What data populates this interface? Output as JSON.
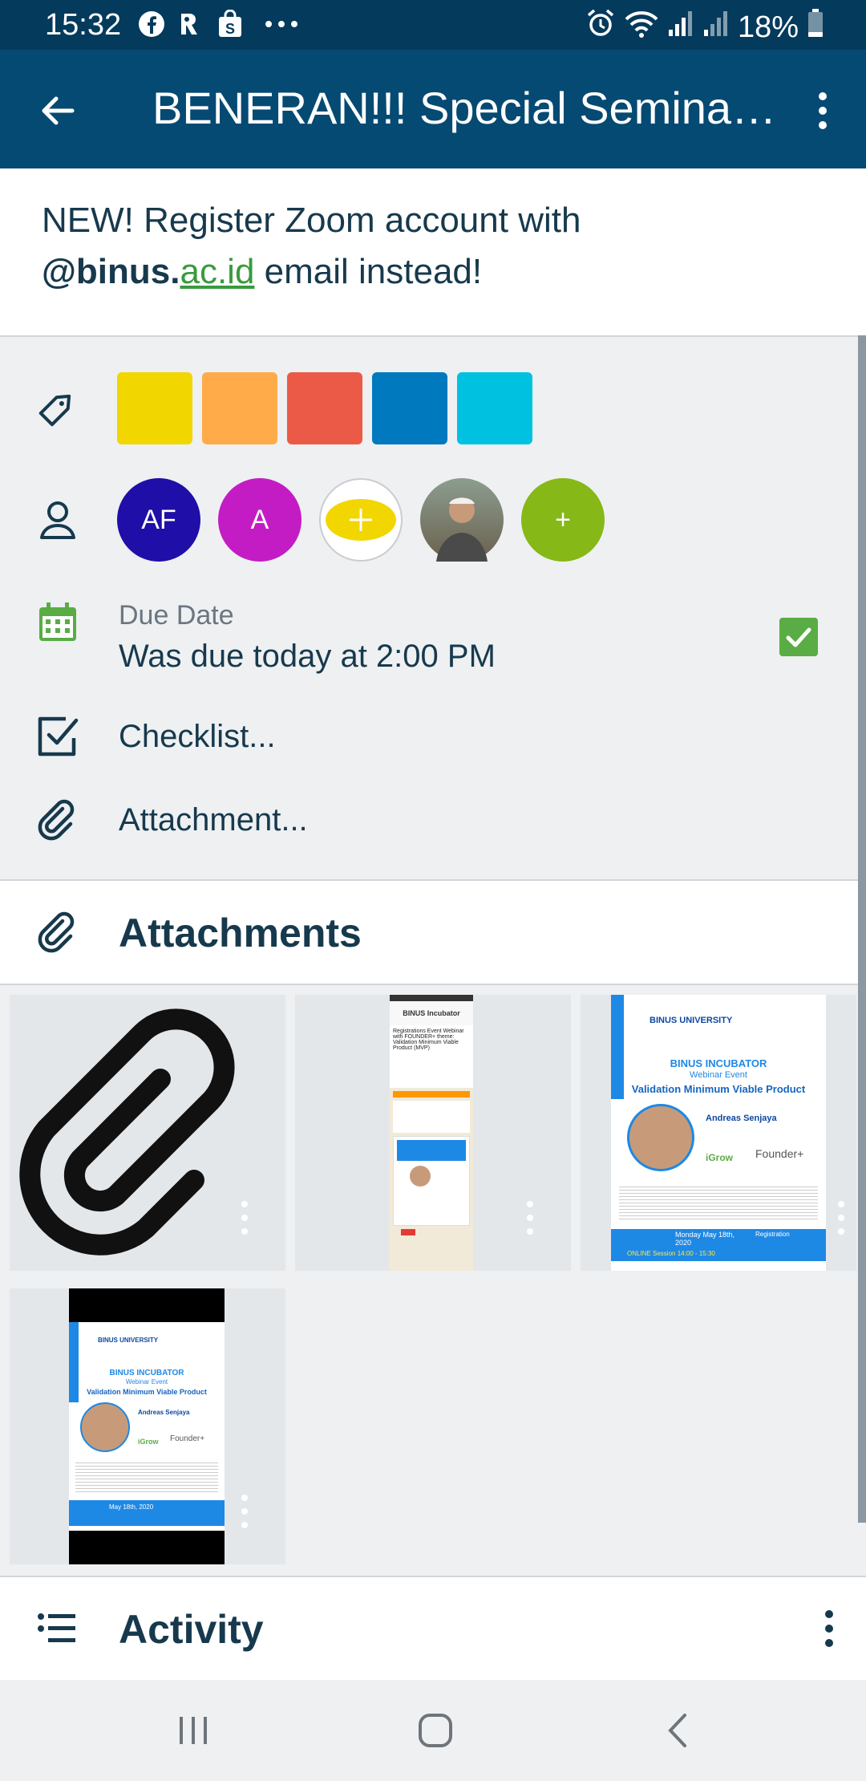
{
  "status_bar": {
    "time": "15:32",
    "notification_icons": [
      "facebook-icon",
      "app-icon",
      "shop-icon",
      "more-notifications-icon"
    ],
    "system_icons": [
      "alarm-icon",
      "wifi-icon",
      "signal-icon",
      "signal-icon-2",
      "battery-icon"
    ],
    "battery": "18%"
  },
  "app_bar": {
    "title": "BENERAN!!! Special Seminar...",
    "back_icon": "arrow-back-icon",
    "more_icon": "more-vert-icon"
  },
  "description": {
    "line1": "NEW! Register Zoom account with",
    "line2_bold": "@binus.",
    "line2_link": "ac.id",
    "line2_rest": " email instead!"
  },
  "labels": {
    "icon": "label-tag-icon",
    "colors": [
      "#f2d600",
      "#ffab4a",
      "#eb5a46",
      "#0079bf",
      "#00c2e0"
    ]
  },
  "members": {
    "icon": "person-icon",
    "avatars": [
      {
        "initials": "AF",
        "color": "#1f0ea8"
      },
      {
        "initials": "A",
        "color": "#c41cc4"
      },
      {
        "initials": "",
        "color": "#f2d600",
        "kind": "emoji"
      },
      {
        "initials": "",
        "color": "#7a6b55",
        "kind": "photo"
      },
      {
        "initials": "+",
        "color": "#86b817"
      }
    ]
  },
  "due_date": {
    "icon": "calendar-icon",
    "label": "Due Date",
    "value": "Was due today at 2:00 PM",
    "complete_icon": "checkbox-checked-icon"
  },
  "checklist": {
    "icon": "checklist-icon",
    "label": "Checklist..."
  },
  "attachment_row": {
    "icon": "attachment-icon",
    "label": "Attachment..."
  },
  "attachments_section": {
    "icon": "attachment-icon",
    "title": "Attachments",
    "thumbs": [
      {
        "type": "paperclip"
      },
      {
        "type": "screenshot",
        "header": "BINUS Incubator",
        "heading": "Registrations Event Webinar with FOUNDER+ theme: Validation Minimum Viable Product (MVP)"
      },
      {
        "type": "poster",
        "brand": "BINUS UNIVERSITY",
        "event": "BINUS INCUBATOR",
        "subtitle": "Webinar Event",
        "topic": "Validation Minimum Viable Product",
        "speaker": "Andreas Senjaya",
        "logo1": "iGrow",
        "logo2": "Founder+",
        "date": "Monday May 18th, 2020",
        "session": "ONLINE Session 14:00 - 15:30",
        "registration": "Registration"
      },
      {
        "type": "poster-portrait",
        "brand": "BINUS UNIVERSITY",
        "event": "BINUS INCUBATOR",
        "subtitle": "Webinar Event",
        "topic": "Validation Minimum Viable Product",
        "speaker": "Andreas Senjaya",
        "logo1": "iGrow",
        "logo2": "Founder+",
        "date": "May 18th, 2020"
      }
    ]
  },
  "activity_section": {
    "icon": "activity-list-icon",
    "title": "Activity",
    "more_icon": "more-vert-icon"
  },
  "nav_bar": {
    "recents_icon": "recents-icon",
    "home_icon": "home-icon",
    "back_icon": "back-icon"
  }
}
